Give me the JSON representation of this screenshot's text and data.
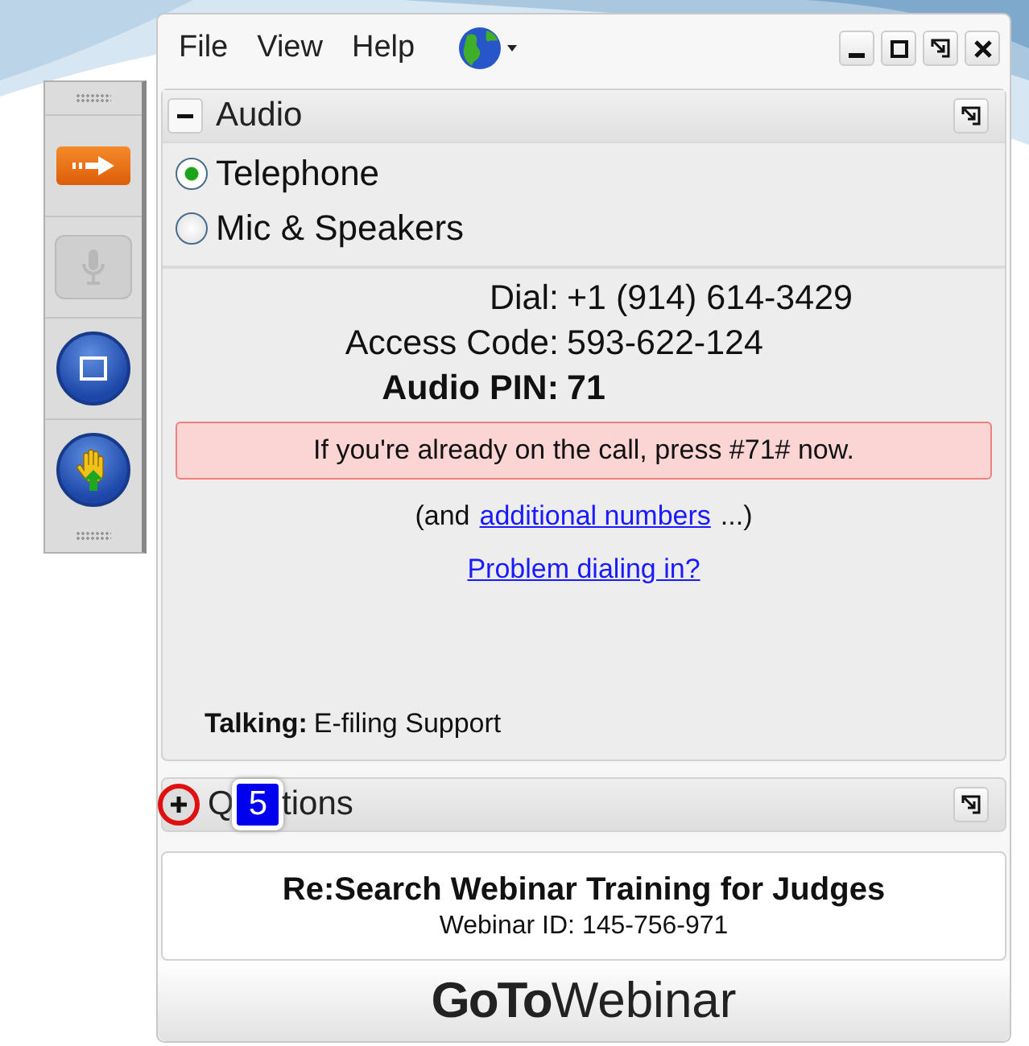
{
  "menu": [
    {
      "label": "File"
    },
    {
      "label": "View"
    },
    {
      "label": "Help"
    }
  ],
  "toolbar": [
    {
      "kind": "arrow",
      "disabled": false
    },
    {
      "kind": "mic",
      "disabled": true
    },
    {
      "kind": "screen",
      "disabled": false
    },
    {
      "kind": "hand",
      "disabled": false
    }
  ],
  "audio": {
    "title": "Audio",
    "expanded": true,
    "options": [
      {
        "label": "Telephone",
        "selected": true
      },
      {
        "label": "Mic & Speakers",
        "selected": false
      }
    ],
    "details": [
      {
        "label": "Dial:",
        "value": "+1 (914) 614-3429",
        "emphasis": false
      },
      {
        "label": "Access Code:",
        "value": "593-622-124",
        "emphasis": false
      },
      {
        "label": "Audio PIN:",
        "value": "71",
        "emphasis": true
      }
    ],
    "notice": "If you're already on the call, press #71# now.",
    "more_before": "(and",
    "more_link": "additional numbers",
    "more_after": "...)",
    "problem_link": "Problem dialing in?",
    "talking_label": "Talking:",
    "talking_name": "E-filing Support"
  },
  "questions": {
    "title_start": "Q",
    "title_end": "tions",
    "expanded": false,
    "callout": "5"
  },
  "webinar": {
    "title": "Re:Search Webinar Training for Judges",
    "id": "Webinar ID: 145-756-971"
  },
  "logo": {
    "bold": "GoTo",
    "light": "Webinar"
  }
}
